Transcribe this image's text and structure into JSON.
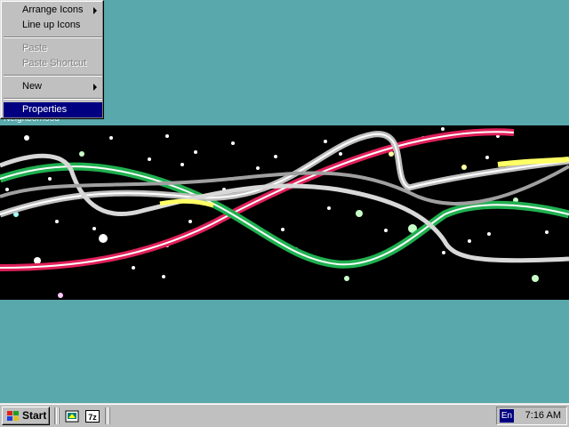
{
  "desktop": {
    "background_color": "#59a9ac",
    "icon_caption": "Neighborhood"
  },
  "context_menu": {
    "items": [
      {
        "label": "Arrange Icons",
        "has_submenu": true,
        "enabled": true
      },
      {
        "label": "Line up Icons",
        "has_submenu": false,
        "enabled": true
      },
      {
        "label": "Paste",
        "has_submenu": false,
        "enabled": false
      },
      {
        "label": "Paste Shortcut",
        "has_submenu": false,
        "enabled": false
      },
      {
        "label": "New",
        "has_submenu": true,
        "enabled": true
      },
      {
        "label": "Properties",
        "has_submenu": false,
        "enabled": true,
        "selected": true
      }
    ],
    "selected_color": "#000080"
  },
  "taskbar": {
    "start_label": "Start",
    "quick_launch": [
      {
        "icon": "desktop-shortcut-icon"
      },
      {
        "icon": "7zip-icon",
        "label": "7z"
      }
    ],
    "tray": {
      "language": "En",
      "clock": "7:16 AM"
    }
  }
}
